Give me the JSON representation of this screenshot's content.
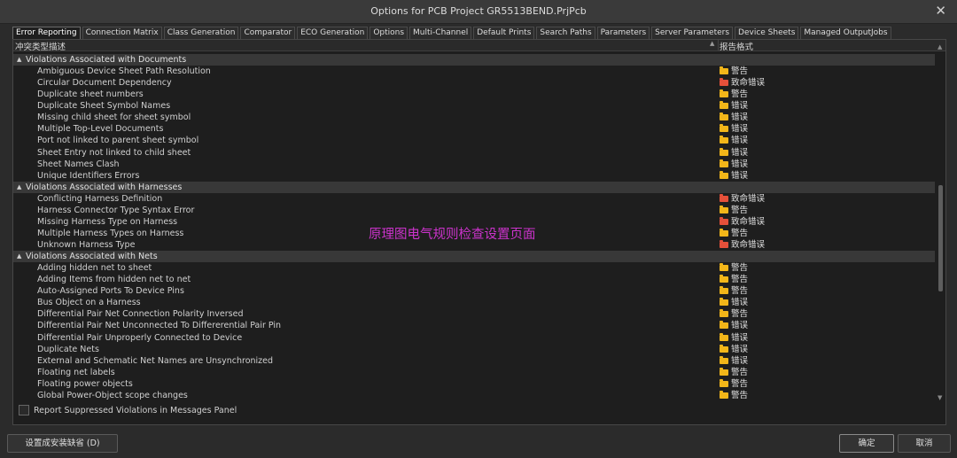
{
  "window": {
    "title": "Options for PCB Project GR5513BEND.PrjPcb",
    "close_glyph": "✕"
  },
  "tabs": [
    {
      "label": "Error Reporting",
      "active": true
    },
    {
      "label": "Connection Matrix"
    },
    {
      "label": "Class Generation"
    },
    {
      "label": "Comparator"
    },
    {
      "label": "ECO Generation"
    },
    {
      "label": "Options"
    },
    {
      "label": "Multi-Channel"
    },
    {
      "label": "Default Prints"
    },
    {
      "label": "Search Paths"
    },
    {
      "label": "Parameters"
    },
    {
      "label": "Server Parameters"
    },
    {
      "label": "Device Sheets"
    },
    {
      "label": "Managed OutputJobs"
    }
  ],
  "table": {
    "col_type": "冲突类型描述",
    "col_level": "报告格式"
  },
  "level_colors": {
    "警告": "#f2b619",
    "错误": "#f2b619",
    "致命错误": "#e5503a"
  },
  "rows": [
    {
      "type": "group",
      "label": "Violations Associated with Documents"
    },
    {
      "type": "item",
      "label": "Ambiguous Device Sheet Path Resolution",
      "level": "警告"
    },
    {
      "type": "item",
      "label": "Circular Document Dependency",
      "level": "致命错误"
    },
    {
      "type": "item",
      "label": "Duplicate sheet numbers",
      "level": "警告"
    },
    {
      "type": "item",
      "label": "Duplicate Sheet Symbol Names",
      "level": "错误"
    },
    {
      "type": "item",
      "label": "Missing child sheet for sheet symbol",
      "level": "错误"
    },
    {
      "type": "item",
      "label": "Multiple Top-Level Documents",
      "level": "错误"
    },
    {
      "type": "item",
      "label": "Port not linked to parent sheet symbol",
      "level": "错误"
    },
    {
      "type": "item",
      "label": "Sheet Entry not linked to child sheet",
      "level": "错误"
    },
    {
      "type": "item",
      "label": "Sheet Names Clash",
      "level": "错误"
    },
    {
      "type": "item",
      "label": "Unique Identifiers Errors",
      "level": "错误"
    },
    {
      "type": "group",
      "label": "Violations Associated with Harnesses"
    },
    {
      "type": "item",
      "label": "Conflicting Harness Definition",
      "level": "致命错误"
    },
    {
      "type": "item",
      "label": "Harness Connector Type Syntax Error",
      "level": "警告"
    },
    {
      "type": "item",
      "label": "Missing Harness Type on Harness",
      "level": "致命错误"
    },
    {
      "type": "item",
      "label": "Multiple Harness Types on Harness",
      "level": "警告"
    },
    {
      "type": "item",
      "label": "Unknown Harness Type",
      "level": "致命错误"
    },
    {
      "type": "group",
      "label": "Violations Associated with Nets"
    },
    {
      "type": "item",
      "label": "Adding hidden net to sheet",
      "level": "警告"
    },
    {
      "type": "item",
      "label": "Adding Items from hidden net to net",
      "level": "警告"
    },
    {
      "type": "item",
      "label": "Auto-Assigned Ports To Device Pins",
      "level": "警告"
    },
    {
      "type": "item",
      "label": "Bus Object on a Harness",
      "level": "错误"
    },
    {
      "type": "item",
      "label": "Differential Pair Net Connection Polarity Inversed",
      "level": "警告"
    },
    {
      "type": "item",
      "label": "Differential Pair Net Unconnected To Differerential Pair Pin",
      "level": "错误"
    },
    {
      "type": "item",
      "label": "Differential Pair Unproperly Connected to Device",
      "level": "错误"
    },
    {
      "type": "item",
      "label": "Duplicate Nets",
      "level": "错误"
    },
    {
      "type": "item",
      "label": "External and Schematic Net Names are Unsynchronized",
      "level": "错误"
    },
    {
      "type": "item",
      "label": "Floating net labels",
      "level": "警告"
    },
    {
      "type": "item",
      "label": "Floating power objects",
      "level": "警告"
    },
    {
      "type": "item",
      "label": "Global Power-Object scope changes",
      "level": "警告"
    }
  ],
  "overlay_text": "原理图电气规则检查设置页面",
  "footer": {
    "report_suppressed": "Report Suppressed Violations in Messages Panel",
    "set_default": "设置成安装缺省 (D)",
    "ok": "确定",
    "cancel": "取消"
  }
}
